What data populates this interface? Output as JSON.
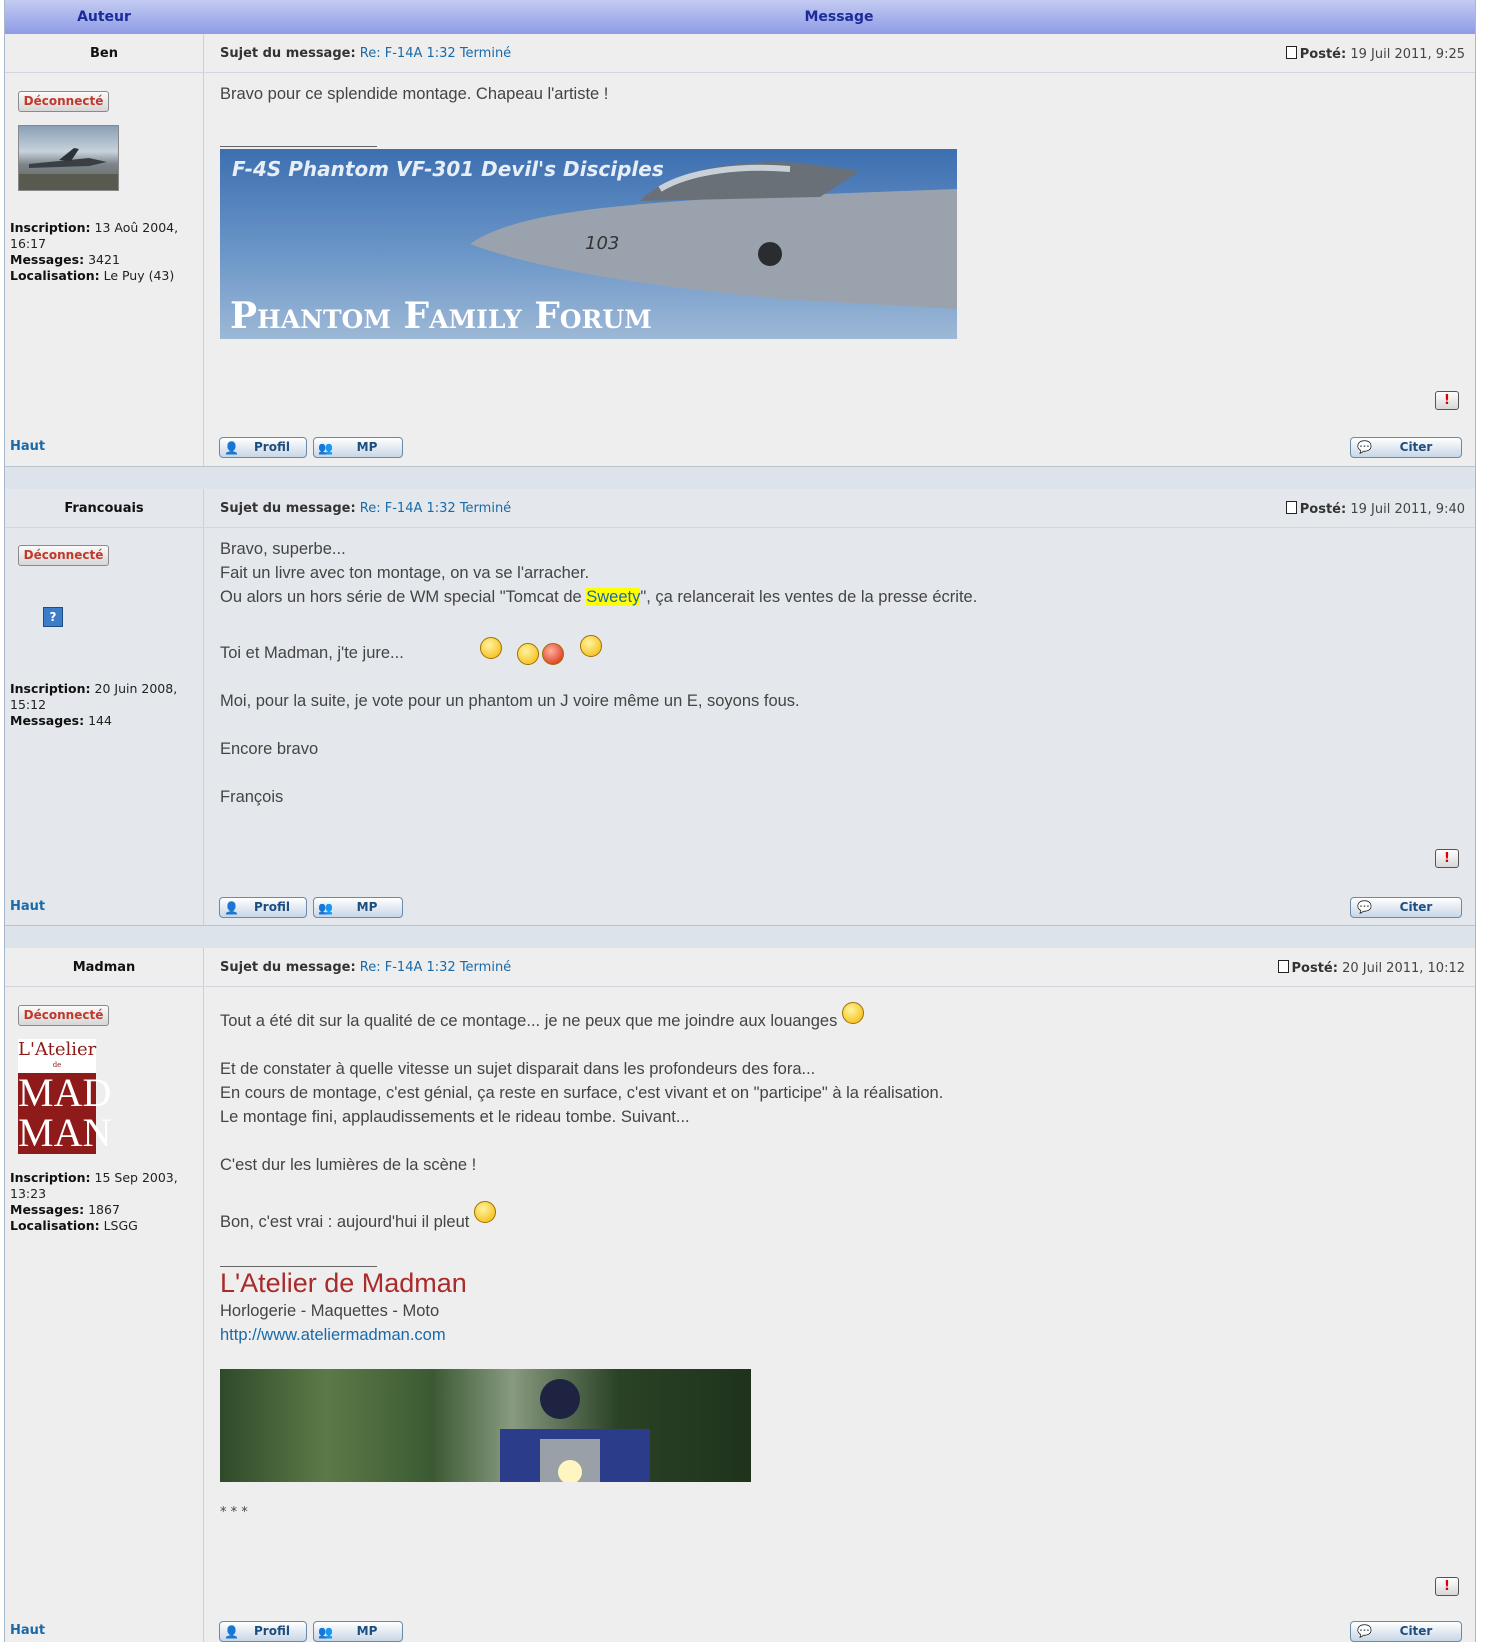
{
  "header": {
    "author_col": "Auteur",
    "message_col": "Message"
  },
  "labels": {
    "subject": "Sujet du message:",
    "posted": "Posté:",
    "offline": "Déconnecté",
    "inscription": "Inscription:",
    "messages": "Messages:",
    "localisation": "Localisation:",
    "top": "Haut",
    "profile": "Profil",
    "pm": "MP",
    "quote": "Citer",
    "report": "!"
  },
  "posts": [
    {
      "author": "Ben",
      "subject": "Re: F-14A 1:32 Terminé",
      "date": "19 Juil 2011, 9:25",
      "inscription": "13 Aoû 2004, 16:17",
      "messages": "3421",
      "localisation": "Le Puy (43)",
      "body": [
        "Bravo pour ce splendide montage. Chapeau l'artiste !"
      ],
      "banner": {
        "top_text": "F-4S Phantom VF-301 Devil's Disciples",
        "bottom_text": "Phantom Family Forum",
        "tail": "103"
      }
    },
    {
      "author": "Francouais",
      "subject": "Re: F-14A 1:32 Terminé",
      "date": "19 Juil 2011, 9:40",
      "inscription": "20 Juin 2008, 15:12",
      "messages": "144",
      "avatar_placeholder": "?",
      "body": [
        "Bravo, superbe...",
        "Fait un livre avec ton montage, on va se l'arracher.",
        "Ou alors un hors série de WM special \"Tomcat de ",
        "Sweety",
        "\", ça relancerait les ventes de la presse écrite.",
        "Toi et Madman, j'te jure...",
        "Moi, pour la suite, je vote pour un phantom un J voire même un E, soyons fous.",
        "Encore bravo",
        "François"
      ]
    },
    {
      "author": "Madman",
      "subject": "Re: F-14A 1:32 Terminé",
      "date": "20 Juil 2011, 10:12",
      "inscription": "15 Sep 2003, 13:23",
      "messages": "1867",
      "localisation": "LSGG",
      "avatar": {
        "line1": "L'Atelier",
        "line2": "de",
        "line3": "MAD",
        "line4": "MAN"
      },
      "body": [
        "Tout a été dit sur la qualité de ce montage... je ne peux que me joindre aux louanges",
        "Et de constater à quelle vitesse un sujet disparait dans les profondeurs des fora...",
        "En cours de montage, c'est génial, ça reste en surface, c'est vivant et on \"participe\" à la réalisation.",
        "Le montage fini, applaudissements et le rideau tombe. Suivant...",
        "C'est dur les lumières de la scène !",
        "Bon, c'est vrai : aujourd'hui il pleut"
      ],
      "signature": {
        "title": "L'Atelier de Madman",
        "subtitle": "Horlogerie - Maquettes - Moto",
        "url": "http://www.ateliermadman.com",
        "stars": "* * *"
      }
    }
  ],
  "colors": {
    "header_gradient_top": "#c3cbf2",
    "header_text": "#1c2b9a",
    "link": "#1a6aa8",
    "offline": "#c0392b",
    "signature_title": "#a92b2b"
  }
}
